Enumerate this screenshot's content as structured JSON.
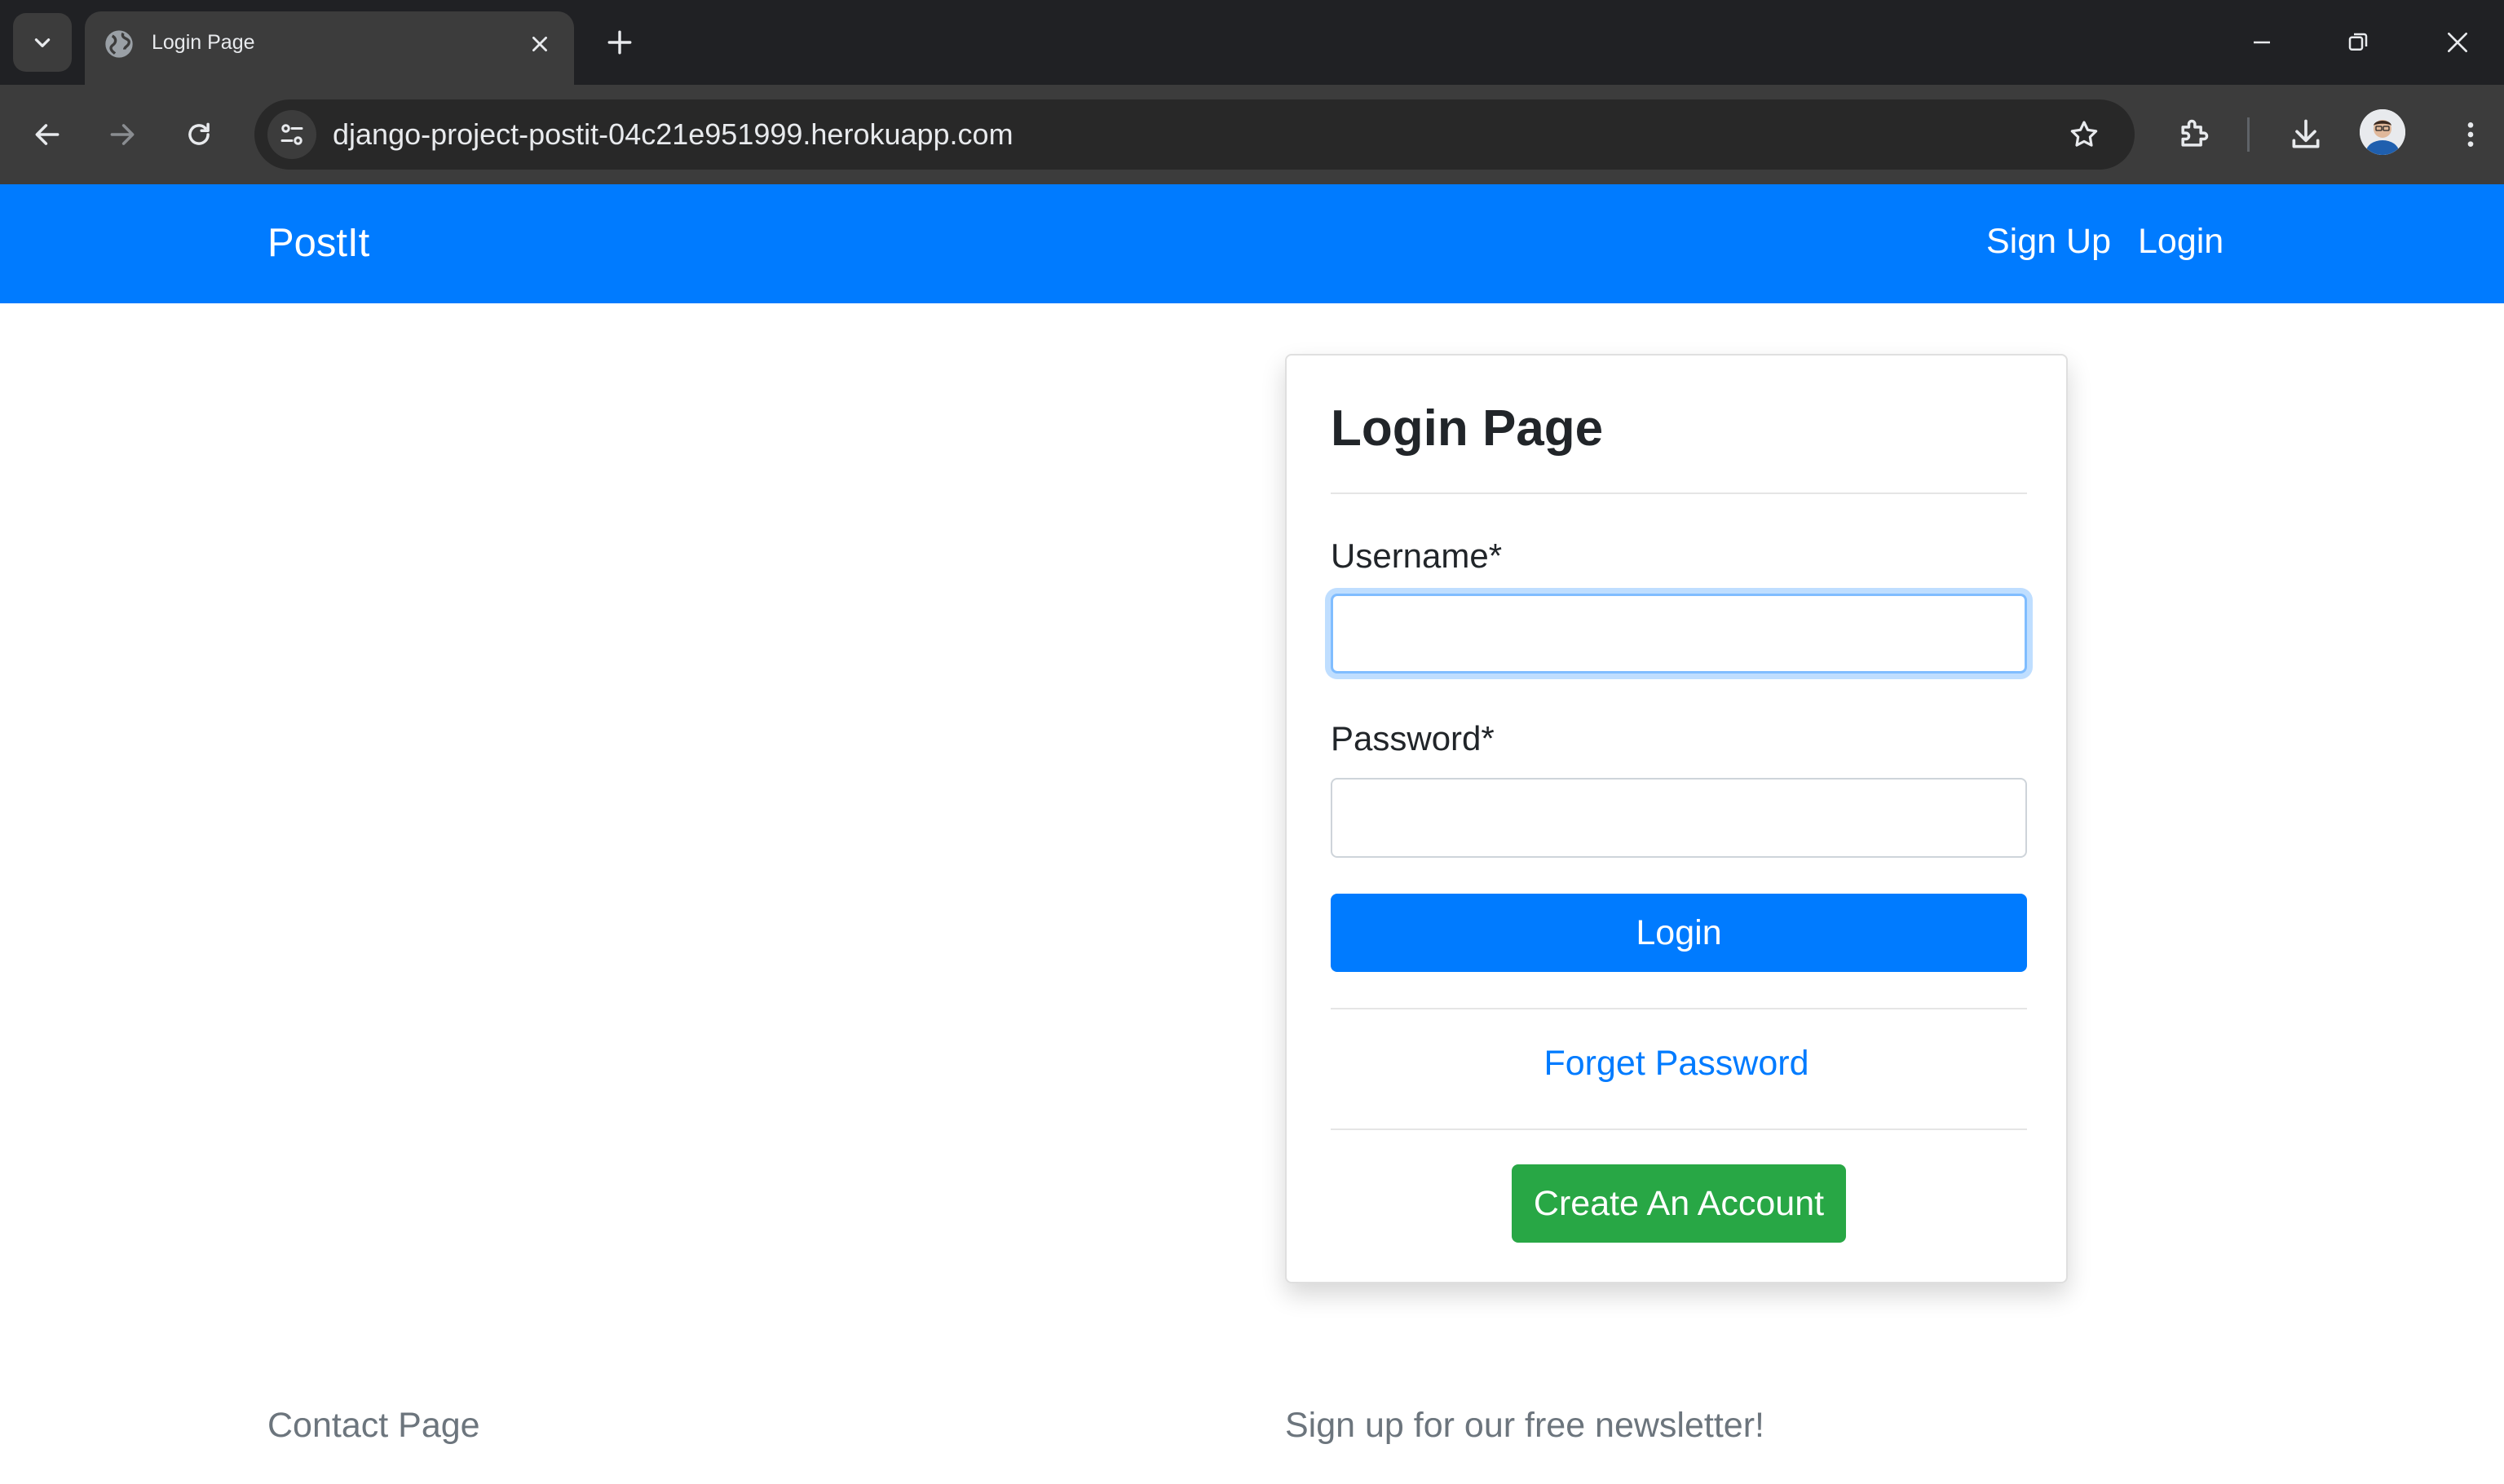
{
  "browser": {
    "tab": {
      "title": "Login Page"
    },
    "url": "django-project-postit-04c21e951999.herokuapp.com"
  },
  "navbar": {
    "brand": "PostIt",
    "links": {
      "signup": "Sign Up",
      "login": "Login"
    }
  },
  "login_card": {
    "title": "Login Page",
    "username": {
      "label": "Username*",
      "value": ""
    },
    "password": {
      "label": "Password*",
      "value": ""
    },
    "login_button": "Login",
    "forget_password": "Forget Password",
    "create_account_button": "Create An Account"
  },
  "footer": {
    "contact": "Contact Page",
    "newsletter": "Sign up for our free newsletter!"
  },
  "colors": {
    "primary": "#007bff",
    "success": "#28a745",
    "chrome_dark": "#202124",
    "chrome_toolbar": "#3c3c3c"
  }
}
